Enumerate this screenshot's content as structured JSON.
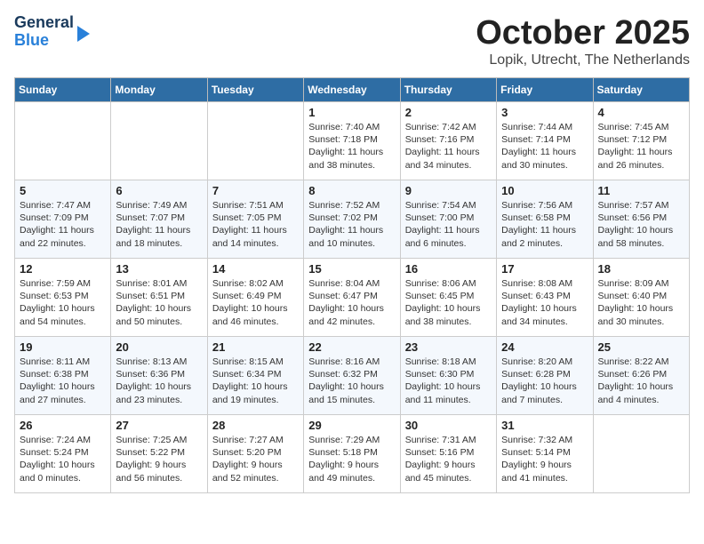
{
  "header": {
    "logo": {
      "line1": "General",
      "line2": "Blue"
    },
    "title": "October 2025",
    "location": "Lopik, Utrecht, The Netherlands"
  },
  "weekdays": [
    "Sunday",
    "Monday",
    "Tuesday",
    "Wednesday",
    "Thursday",
    "Friday",
    "Saturday"
  ],
  "weeks": [
    [
      {
        "day": "",
        "info": ""
      },
      {
        "day": "",
        "info": ""
      },
      {
        "day": "",
        "info": ""
      },
      {
        "day": "1",
        "info": "Sunrise: 7:40 AM\nSunset: 7:18 PM\nDaylight: 11 hours\nand 38 minutes."
      },
      {
        "day": "2",
        "info": "Sunrise: 7:42 AM\nSunset: 7:16 PM\nDaylight: 11 hours\nand 34 minutes."
      },
      {
        "day": "3",
        "info": "Sunrise: 7:44 AM\nSunset: 7:14 PM\nDaylight: 11 hours\nand 30 minutes."
      },
      {
        "day": "4",
        "info": "Sunrise: 7:45 AM\nSunset: 7:12 PM\nDaylight: 11 hours\nand 26 minutes."
      }
    ],
    [
      {
        "day": "5",
        "info": "Sunrise: 7:47 AM\nSunset: 7:09 PM\nDaylight: 11 hours\nand 22 minutes."
      },
      {
        "day": "6",
        "info": "Sunrise: 7:49 AM\nSunset: 7:07 PM\nDaylight: 11 hours\nand 18 minutes."
      },
      {
        "day": "7",
        "info": "Sunrise: 7:51 AM\nSunset: 7:05 PM\nDaylight: 11 hours\nand 14 minutes."
      },
      {
        "day": "8",
        "info": "Sunrise: 7:52 AM\nSunset: 7:02 PM\nDaylight: 11 hours\nand 10 minutes."
      },
      {
        "day": "9",
        "info": "Sunrise: 7:54 AM\nSunset: 7:00 PM\nDaylight: 11 hours\nand 6 minutes."
      },
      {
        "day": "10",
        "info": "Sunrise: 7:56 AM\nSunset: 6:58 PM\nDaylight: 11 hours\nand 2 minutes."
      },
      {
        "day": "11",
        "info": "Sunrise: 7:57 AM\nSunset: 6:56 PM\nDaylight: 10 hours\nand 58 minutes."
      }
    ],
    [
      {
        "day": "12",
        "info": "Sunrise: 7:59 AM\nSunset: 6:53 PM\nDaylight: 10 hours\nand 54 minutes."
      },
      {
        "day": "13",
        "info": "Sunrise: 8:01 AM\nSunset: 6:51 PM\nDaylight: 10 hours\nand 50 minutes."
      },
      {
        "day": "14",
        "info": "Sunrise: 8:02 AM\nSunset: 6:49 PM\nDaylight: 10 hours\nand 46 minutes."
      },
      {
        "day": "15",
        "info": "Sunrise: 8:04 AM\nSunset: 6:47 PM\nDaylight: 10 hours\nand 42 minutes."
      },
      {
        "day": "16",
        "info": "Sunrise: 8:06 AM\nSunset: 6:45 PM\nDaylight: 10 hours\nand 38 minutes."
      },
      {
        "day": "17",
        "info": "Sunrise: 8:08 AM\nSunset: 6:43 PM\nDaylight: 10 hours\nand 34 minutes."
      },
      {
        "day": "18",
        "info": "Sunrise: 8:09 AM\nSunset: 6:40 PM\nDaylight: 10 hours\nand 30 minutes."
      }
    ],
    [
      {
        "day": "19",
        "info": "Sunrise: 8:11 AM\nSunset: 6:38 PM\nDaylight: 10 hours\nand 27 minutes."
      },
      {
        "day": "20",
        "info": "Sunrise: 8:13 AM\nSunset: 6:36 PM\nDaylight: 10 hours\nand 23 minutes."
      },
      {
        "day": "21",
        "info": "Sunrise: 8:15 AM\nSunset: 6:34 PM\nDaylight: 10 hours\nand 19 minutes."
      },
      {
        "day": "22",
        "info": "Sunrise: 8:16 AM\nSunset: 6:32 PM\nDaylight: 10 hours\nand 15 minutes."
      },
      {
        "day": "23",
        "info": "Sunrise: 8:18 AM\nSunset: 6:30 PM\nDaylight: 10 hours\nand 11 minutes."
      },
      {
        "day": "24",
        "info": "Sunrise: 8:20 AM\nSunset: 6:28 PM\nDaylight: 10 hours\nand 7 minutes."
      },
      {
        "day": "25",
        "info": "Sunrise: 8:22 AM\nSunset: 6:26 PM\nDaylight: 10 hours\nand 4 minutes."
      }
    ],
    [
      {
        "day": "26",
        "info": "Sunrise: 7:24 AM\nSunset: 5:24 PM\nDaylight: 10 hours\nand 0 minutes."
      },
      {
        "day": "27",
        "info": "Sunrise: 7:25 AM\nSunset: 5:22 PM\nDaylight: 9 hours\nand 56 minutes."
      },
      {
        "day": "28",
        "info": "Sunrise: 7:27 AM\nSunset: 5:20 PM\nDaylight: 9 hours\nand 52 minutes."
      },
      {
        "day": "29",
        "info": "Sunrise: 7:29 AM\nSunset: 5:18 PM\nDaylight: 9 hours\nand 49 minutes."
      },
      {
        "day": "30",
        "info": "Sunrise: 7:31 AM\nSunset: 5:16 PM\nDaylight: 9 hours\nand 45 minutes."
      },
      {
        "day": "31",
        "info": "Sunrise: 7:32 AM\nSunset: 5:14 PM\nDaylight: 9 hours\nand 41 minutes."
      },
      {
        "day": "",
        "info": ""
      }
    ]
  ]
}
